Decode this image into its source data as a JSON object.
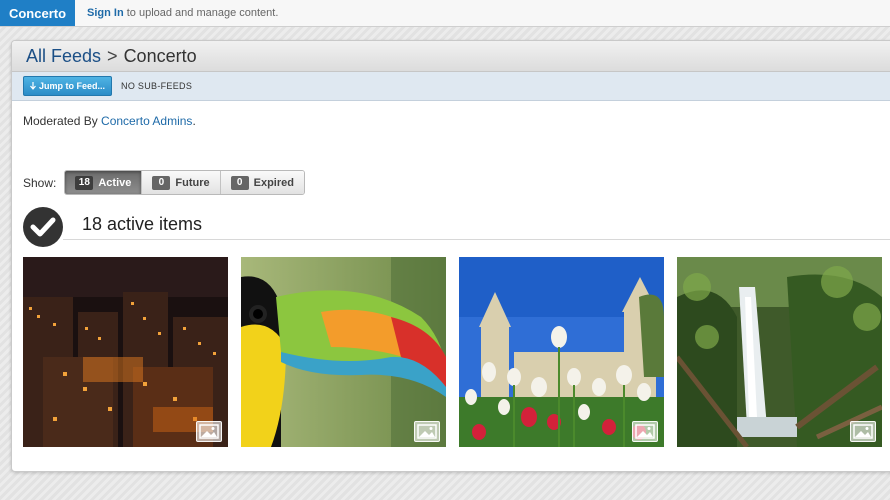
{
  "topbar": {
    "brand": "Concerto",
    "signin_link": "Sign In",
    "signin_text": " to upload and manage content."
  },
  "panel": {
    "breadcrumb_root": "All Feeds",
    "breadcrumb_sep": ">",
    "breadcrumb_current": "Concerto",
    "jump_button": "Jump to Feed...",
    "subfeeds": "NO SUB-FEEDS",
    "moderated_prefix": "Moderated By ",
    "moderated_link": "Concerto Admins",
    "moderated_suffix": "."
  },
  "filter": {
    "label": "Show:",
    "options": [
      {
        "count": "18",
        "label": "Active",
        "selected": true
      },
      {
        "count": "0",
        "label": "Future",
        "selected": false
      },
      {
        "count": "0",
        "label": "Expired",
        "selected": false
      }
    ]
  },
  "items": {
    "title": "18 active items",
    "thumbnails": [
      {
        "subject": "city-night",
        "icon": "image-icon"
      },
      {
        "subject": "toucan",
        "icon": "image-icon"
      },
      {
        "subject": "tulips-church",
        "icon": "image-icon"
      },
      {
        "subject": "waterfall",
        "icon": "image-icon"
      }
    ]
  },
  "colors": {
    "brand": "#1f7fc6",
    "link": "#1e6aa8",
    "subbar": "#dfe8f1"
  }
}
